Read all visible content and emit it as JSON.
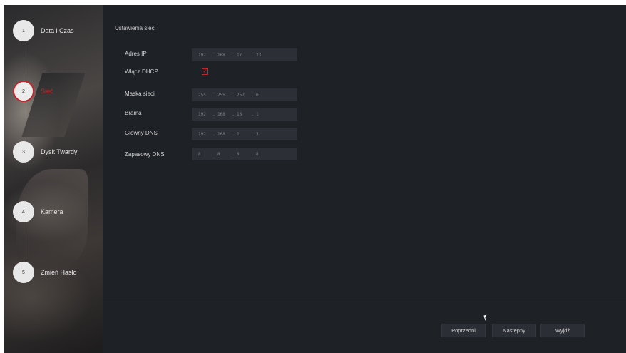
{
  "wizard": {
    "steps": [
      {
        "number": "1",
        "label": "Data i Czas"
      },
      {
        "number": "2",
        "label": "Sieć"
      },
      {
        "number": "3",
        "label": "Dysk Twardy"
      },
      {
        "number": "4",
        "label": "Kamera"
      },
      {
        "number": "5",
        "label": "Zmień Hasło"
      }
    ],
    "active_step": 2
  },
  "network": {
    "title": "Ustawienia sieci",
    "ip_label": "Adres IP",
    "ip": [
      "192",
      "168",
      "17",
      "23"
    ],
    "dhcp_label": "Włącz DHCP",
    "dhcp_checked": true,
    "mask_label": "Maska sieci",
    "mask": [
      "255",
      "255",
      "252",
      "0"
    ],
    "gateway_label": "Brama",
    "gateway": [
      "192",
      "168",
      "16",
      "1"
    ],
    "dns1_label": "Główny DNS",
    "dns1": [
      "192",
      "168",
      "1",
      "3"
    ],
    "dns2_label": "Zapasowy DNS",
    "dns2": [
      "8",
      "8",
      "8",
      "8"
    ]
  },
  "footer": {
    "prev_label": "Poprzedni",
    "next_label": "Następny",
    "exit_label": "Wyjdź"
  },
  "colors": {
    "accent": "#c0262b",
    "panel_bg": "#1e2126",
    "field_bg": "#2c2f35"
  }
}
